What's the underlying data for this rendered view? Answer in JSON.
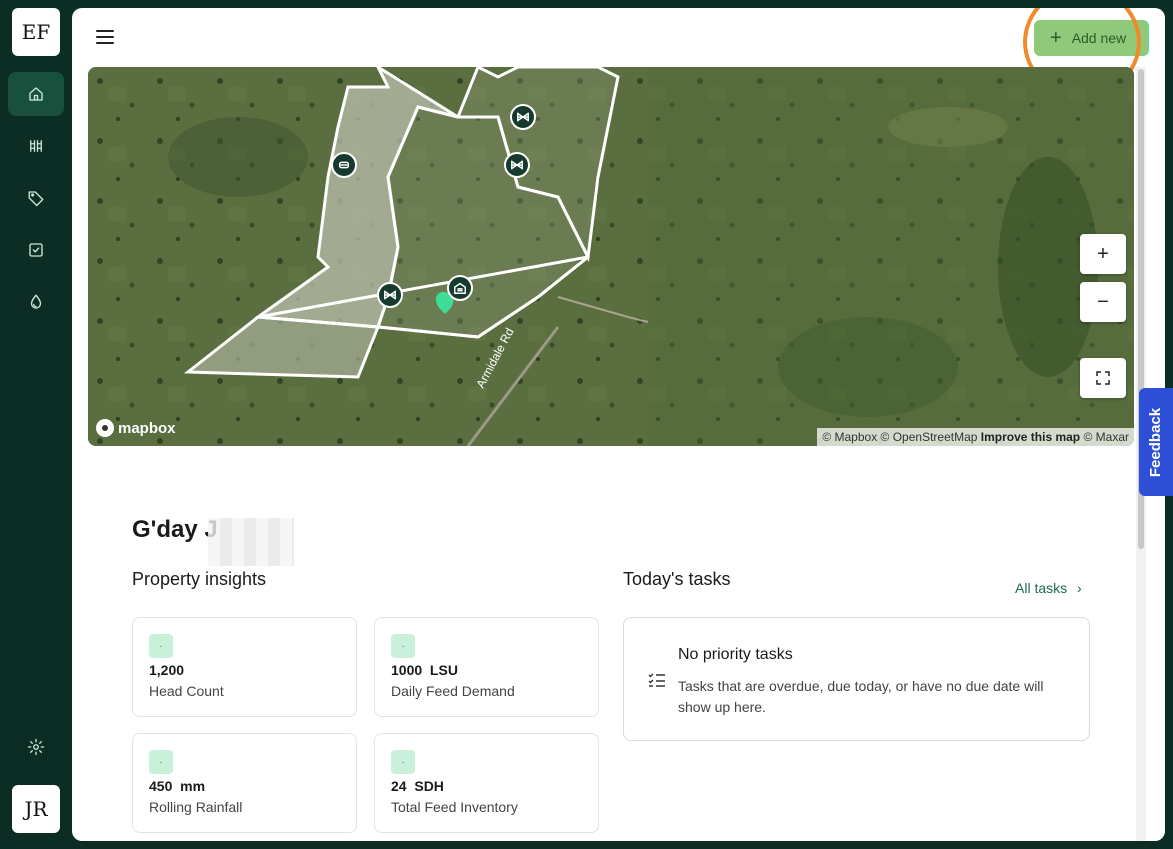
{
  "app": {
    "logo": "EF",
    "user_initials": "JR"
  },
  "sidebar": {
    "items": [
      {
        "icon": "home-icon",
        "active": true
      },
      {
        "icon": "paddocks-icon",
        "active": false
      },
      {
        "icon": "tag-icon",
        "active": false
      },
      {
        "icon": "checkbox-icon",
        "active": false
      },
      {
        "icon": "water-icon",
        "active": false
      }
    ],
    "settings_icon": "gear-icon"
  },
  "header": {
    "add_new_label": "Add new"
  },
  "map": {
    "road_label": "Armidale Rd",
    "mapbox_label": "mapbox",
    "attribution": {
      "mapbox": "© Mapbox",
      "osm": "© OpenStreetMap",
      "improve": "Improve this map",
      "maxar": "© Maxar"
    },
    "controls": {
      "zoom_in": "+",
      "zoom_out": "−",
      "fullscreen": "⛶"
    }
  },
  "feedback_label": "Feedback",
  "greeting": "G'day J",
  "insights": {
    "title": "Property insights",
    "cards": [
      {
        "value": "1,200",
        "label": "Head Count"
      },
      {
        "value": "1000  LSU",
        "label": "Daily Feed Demand"
      },
      {
        "value": "450  mm",
        "label": "Rolling Rainfall"
      },
      {
        "value": "24  SDH",
        "label": "Total Feed Inventory"
      }
    ]
  },
  "tasks": {
    "title": "Today's tasks",
    "all_tasks_label": "All tasks",
    "empty_title": "No priority tasks",
    "empty_desc": "Tasks that are overdue, due today, or have no due date will show up here."
  },
  "colors": {
    "sidebar_bg": "#0c2d23",
    "accent_green": "#8fc97a",
    "highlight": "#f08a2a",
    "feedback": "#2d4fd6"
  }
}
